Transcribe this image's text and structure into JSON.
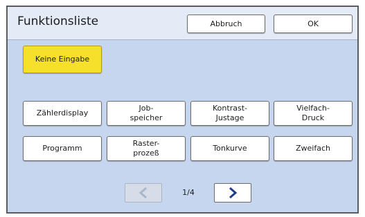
{
  "header": {
    "title": "Funktionsliste",
    "cancel_label": "Abbruch",
    "ok_label": "OK"
  },
  "no_input_label": "Keine Eingabe",
  "functions": {
    "row1": [
      {
        "label": "Zählerdisplay"
      },
      {
        "label": "Job-\nspeicher"
      },
      {
        "label": "Kontrast-\nJustage"
      },
      {
        "label": "Vielfach-\nDruck"
      }
    ],
    "row2": [
      {
        "label": "Programm"
      },
      {
        "label": "Raster-\nprozeß"
      },
      {
        "label": "Tonkurve"
      },
      {
        "label": "Zweifach"
      }
    ]
  },
  "pagination": {
    "page_indicator": "1/4",
    "prev_enabled": false,
    "next_enabled": true
  },
  "colors": {
    "panel_bg": "#c6d6ee",
    "header_bg": "#e4ebf6",
    "highlight_yellow": "#f7e02c",
    "arrow_active": "#1d3c8a",
    "arrow_disabled": "#a8b6cc"
  }
}
